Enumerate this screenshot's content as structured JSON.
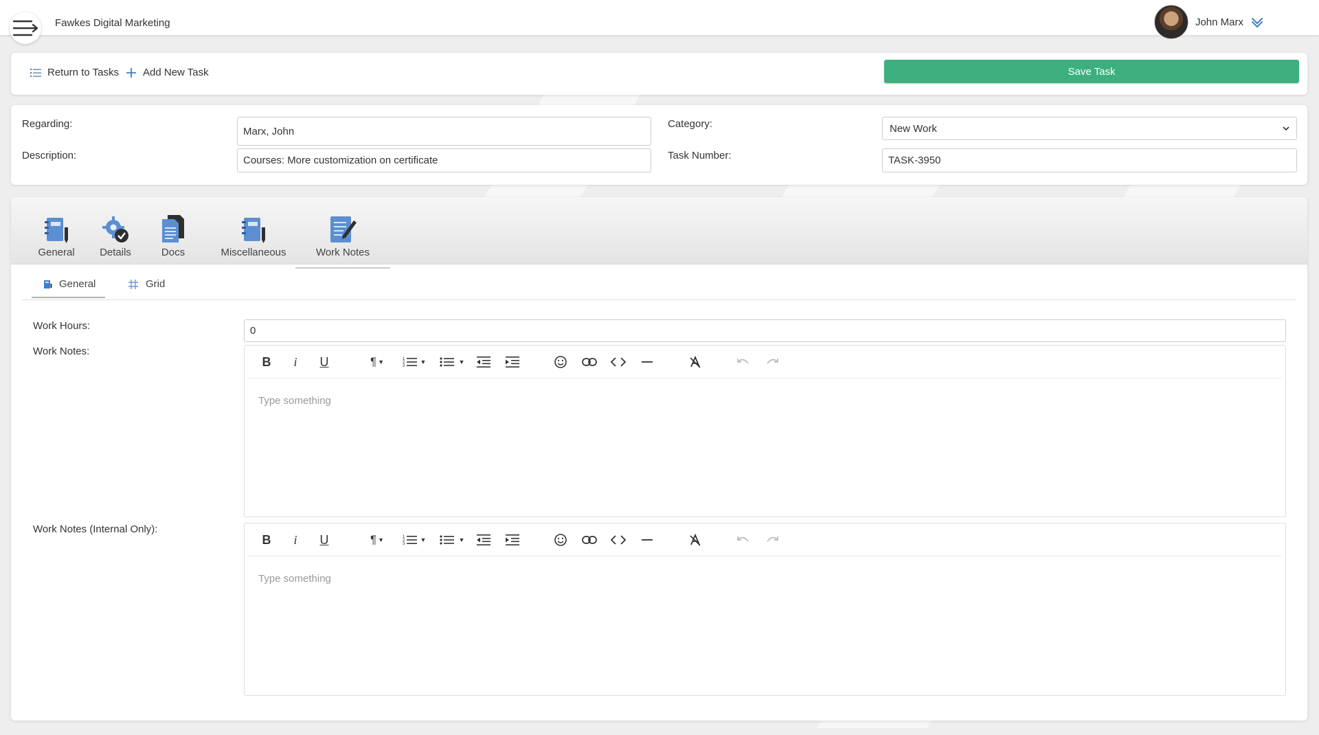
{
  "header": {
    "company": "Fawkes Digital Marketing",
    "user_name": "John Marx"
  },
  "toolbar": {
    "return_label": "Return to Tasks",
    "add_label": "Add New Task",
    "save_label": "Save Task"
  },
  "form": {
    "regarding_label": "Regarding:",
    "regarding_value": "Marx, John",
    "description_label": "Description:",
    "description_value": "Courses: More customization on certificate",
    "category_label": "Category:",
    "category_value": "New Work",
    "task_number_label": "Task Number:",
    "task_number_value": "TASK-3950"
  },
  "tabs": [
    {
      "label": "General",
      "icon": "notebook-icon"
    },
    {
      "label": "Details",
      "icon": "gear-check-icon"
    },
    {
      "label": "Docs",
      "icon": "documents-icon"
    },
    {
      "label": "Miscellaneous",
      "icon": "notebook-icon"
    },
    {
      "label": "Work Notes",
      "icon": "note-edit-icon"
    }
  ],
  "active_tab": "Work Notes",
  "sub_tabs": [
    {
      "label": "General",
      "icon": "notebook-small-icon"
    },
    {
      "label": "Grid",
      "icon": "grid-hash-icon"
    }
  ],
  "work": {
    "hours_label": "Work Hours:",
    "hours_value": "0",
    "notes_label": "Work Notes:",
    "notes_placeholder": "Type something",
    "internal_label": "Work Notes (Internal Only):",
    "internal_placeholder": "Type something"
  },
  "colors": {
    "accent_green": "#3daf7f",
    "icon_blue": "#5b8fd1"
  }
}
